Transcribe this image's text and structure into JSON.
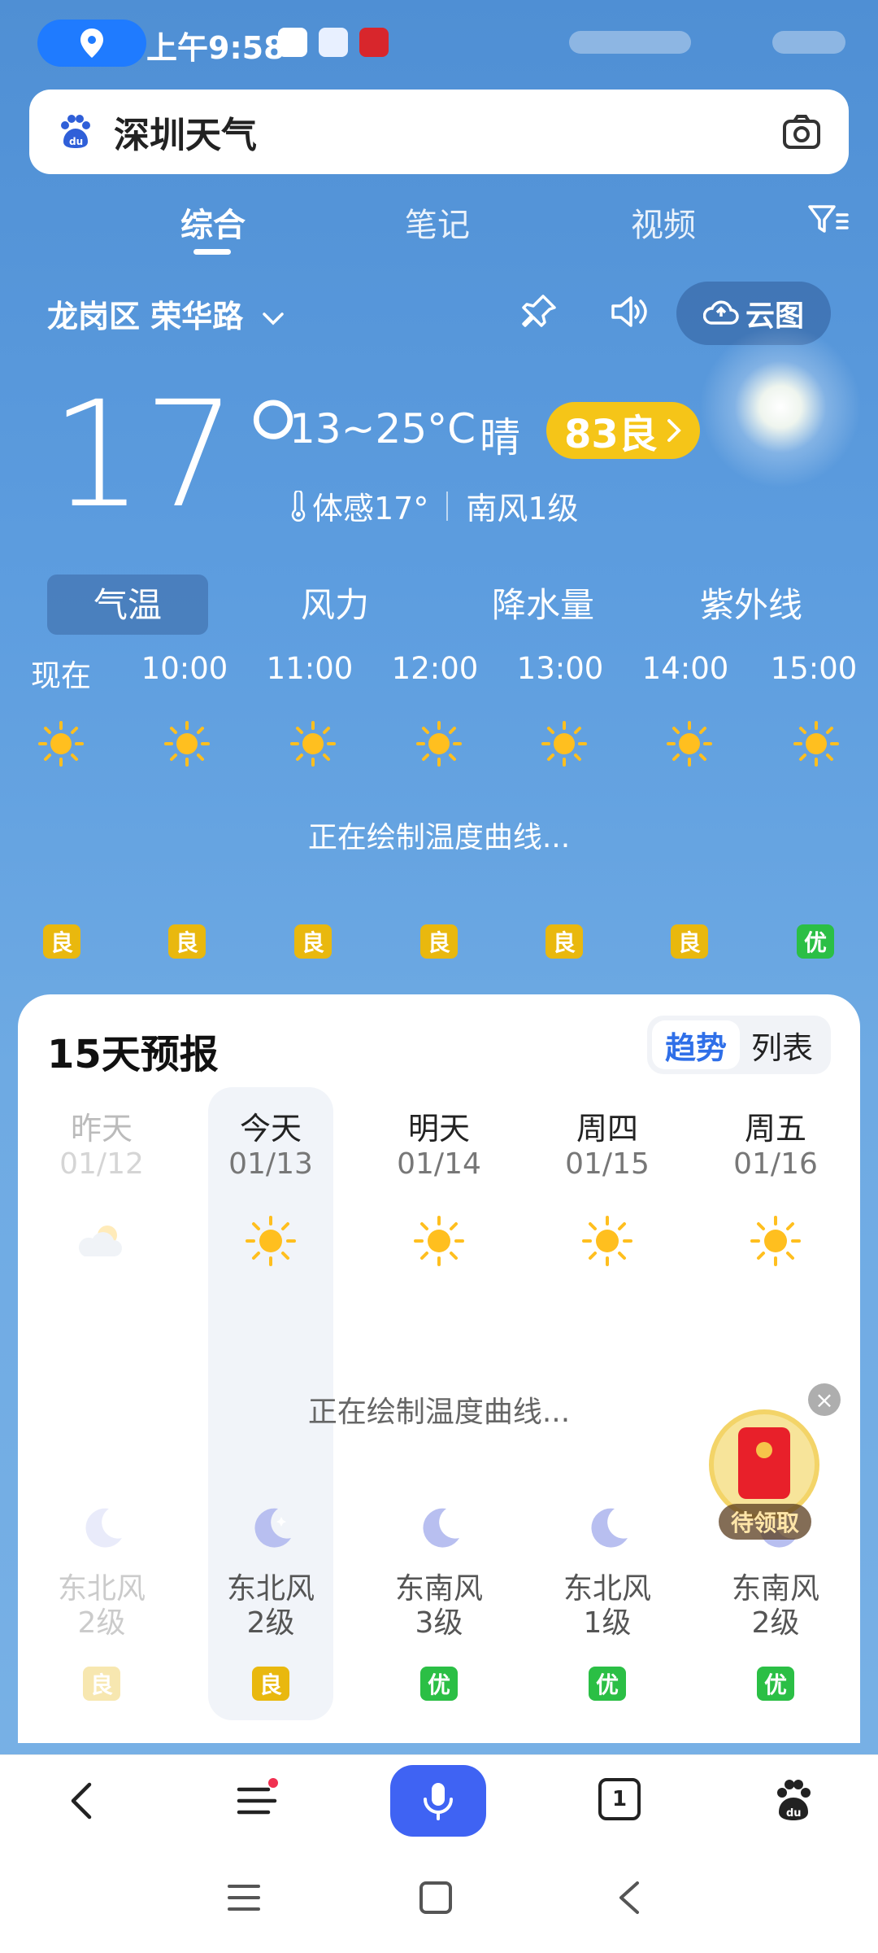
{
  "status_bar": {
    "time": "上午9:58"
  },
  "search": {
    "query": "深圳天气"
  },
  "tabs": [
    {
      "label": "综合"
    },
    {
      "label": "笔记"
    },
    {
      "label": "视频"
    }
  ],
  "location": {
    "text": "龙岗区 荣华路"
  },
  "cloud_button": {
    "label": "云图"
  },
  "current": {
    "temp": "17°",
    "range": "13~25°C",
    "condition": "晴",
    "aqi": "83良",
    "feels": "体感17°",
    "wind": "南风1级"
  },
  "segments": [
    {
      "label": "气温"
    },
    {
      "label": "风力"
    },
    {
      "label": "降水量"
    },
    {
      "label": "紫外线"
    }
  ],
  "hourly": [
    {
      "time": "现在",
      "aq": "良"
    },
    {
      "time": "10:00",
      "aq": "良"
    },
    {
      "time": "11:00",
      "aq": "良"
    },
    {
      "time": "12:00",
      "aq": "良"
    },
    {
      "time": "13:00",
      "aq": "良"
    },
    {
      "time": "14:00",
      "aq": "良"
    },
    {
      "time": "15:00",
      "aq": "优"
    }
  ],
  "drawing_text": "正在绘制温度曲线...",
  "forecast": {
    "title": "15天预报",
    "toggle_trend": "趋势",
    "toggle_list": "列表",
    "days": [
      {
        "name": "昨天",
        "date": "01/12",
        "wind1": "东北风",
        "wind2": "2级",
        "aq": "良"
      },
      {
        "name": "今天",
        "date": "01/13",
        "wind1": "东北风",
        "wind2": "2级",
        "aq": "良"
      },
      {
        "name": "明天",
        "date": "01/14",
        "wind1": "东南风",
        "wind2": "3级",
        "aq": "优"
      },
      {
        "name": "周四",
        "date": "01/15",
        "wind1": "东北风",
        "wind2": "1级",
        "aq": "优"
      },
      {
        "name": "周五",
        "date": "01/16",
        "wind1": "东南风",
        "wind2": "2级",
        "aq": "优"
      }
    ]
  },
  "red_packet": {
    "label": "待领取"
  },
  "nav": {
    "tabs_count": "1"
  }
}
